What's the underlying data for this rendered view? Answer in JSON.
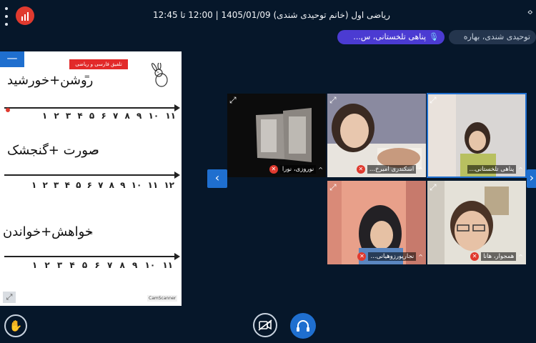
{
  "header": {
    "title": "ریاضی اول (خانم توحیدی شندی) 1405/01/09 | 12:00 تا 12:45",
    "collapse_glyph": "‹›"
  },
  "presenters": {
    "talking_label": "پناهی تلخستانی، س...",
    "other_label": "توحیدی شندی، بهاره"
  },
  "whiteboard": {
    "minimize_glyph": "—",
    "banner": "تلفیق فارسی و ریاضی",
    "equations": [
      "روشن+خورشید",
      "صورت +گنجشک",
      "خواهش+خواندن"
    ],
    "equals_sign": "=",
    "number_lines": [
      "11 10 9 8 7 6 5 4 3 2 1",
      "12 11 10 9 8 7 6 5 4 3 2 1",
      "11 10 9 8 7 6 5 4 3 2 1"
    ],
    "number_lines_fa": [
      "۱۱ ۱۰ ۹ ۸ ۷ ۶ ۵ ۴ ۳ ۲ ۱",
      "۱۲ ۱۱ ۱۰ ۹ ۸ ۷ ۶ ۵ ۴ ۳ ۲ ۱",
      "۱۱ ۱۰ ۹ ۸ ۷ ۶ ۵ ۴ ۳ ۲ ۱"
    ],
    "watermark": "CamScanner"
  },
  "participants": [
    {
      "name": "نوروزی، نورا",
      "muted": true
    },
    {
      "name": "اسکندری امیرخ...",
      "muted": true
    },
    {
      "name": "پناهی تلخستانی...",
      "muted": false,
      "active": true
    },
    {
      "name": "نجارپورزوهیانی...",
      "muted": true
    },
    {
      "name": "همجوار، هانا",
      "muted": true
    }
  ],
  "colors": {
    "background": "#06172a",
    "accent": "#1f6fcf",
    "talking": "#4b3bd2",
    "muted": "#e03a2f"
  },
  "icons": {
    "raise_hand": "✋",
    "expand": "⤢",
    "prev": "‹",
    "next": "›"
  }
}
